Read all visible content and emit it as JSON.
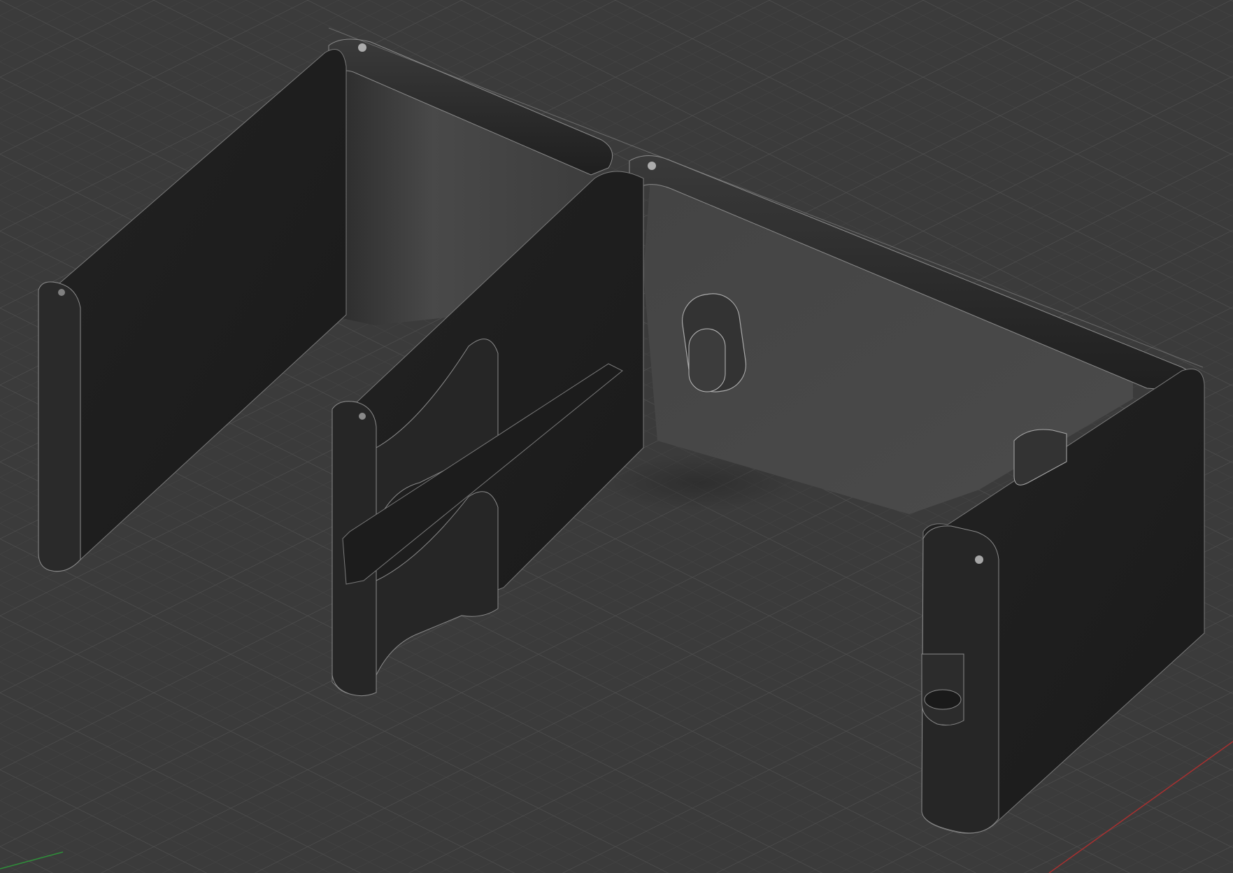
{
  "viewport": {
    "description_role": "3d-cad-viewport",
    "background_color": "#3b3b3b",
    "grid_minor_color": "#474747",
    "grid_major_color": "#525252",
    "model_body_color": "#1e1e1e",
    "model_face_light": "#4a4a4a",
    "model_face_mid": "#2e2e2e",
    "edge_highlight_color": "#9a9a9a",
    "x_axis_color": "#b03030",
    "y_axis_color": "#2f8f3a"
  },
  "model": {
    "name": "dual-bay-bracket",
    "features": [
      "left-wall",
      "back-wall",
      "divider-wall-with-notches",
      "right-bay-back-wall",
      "right-end-wall-with-slot",
      "oval-mounting-boss",
      "clip-tab"
    ]
  }
}
